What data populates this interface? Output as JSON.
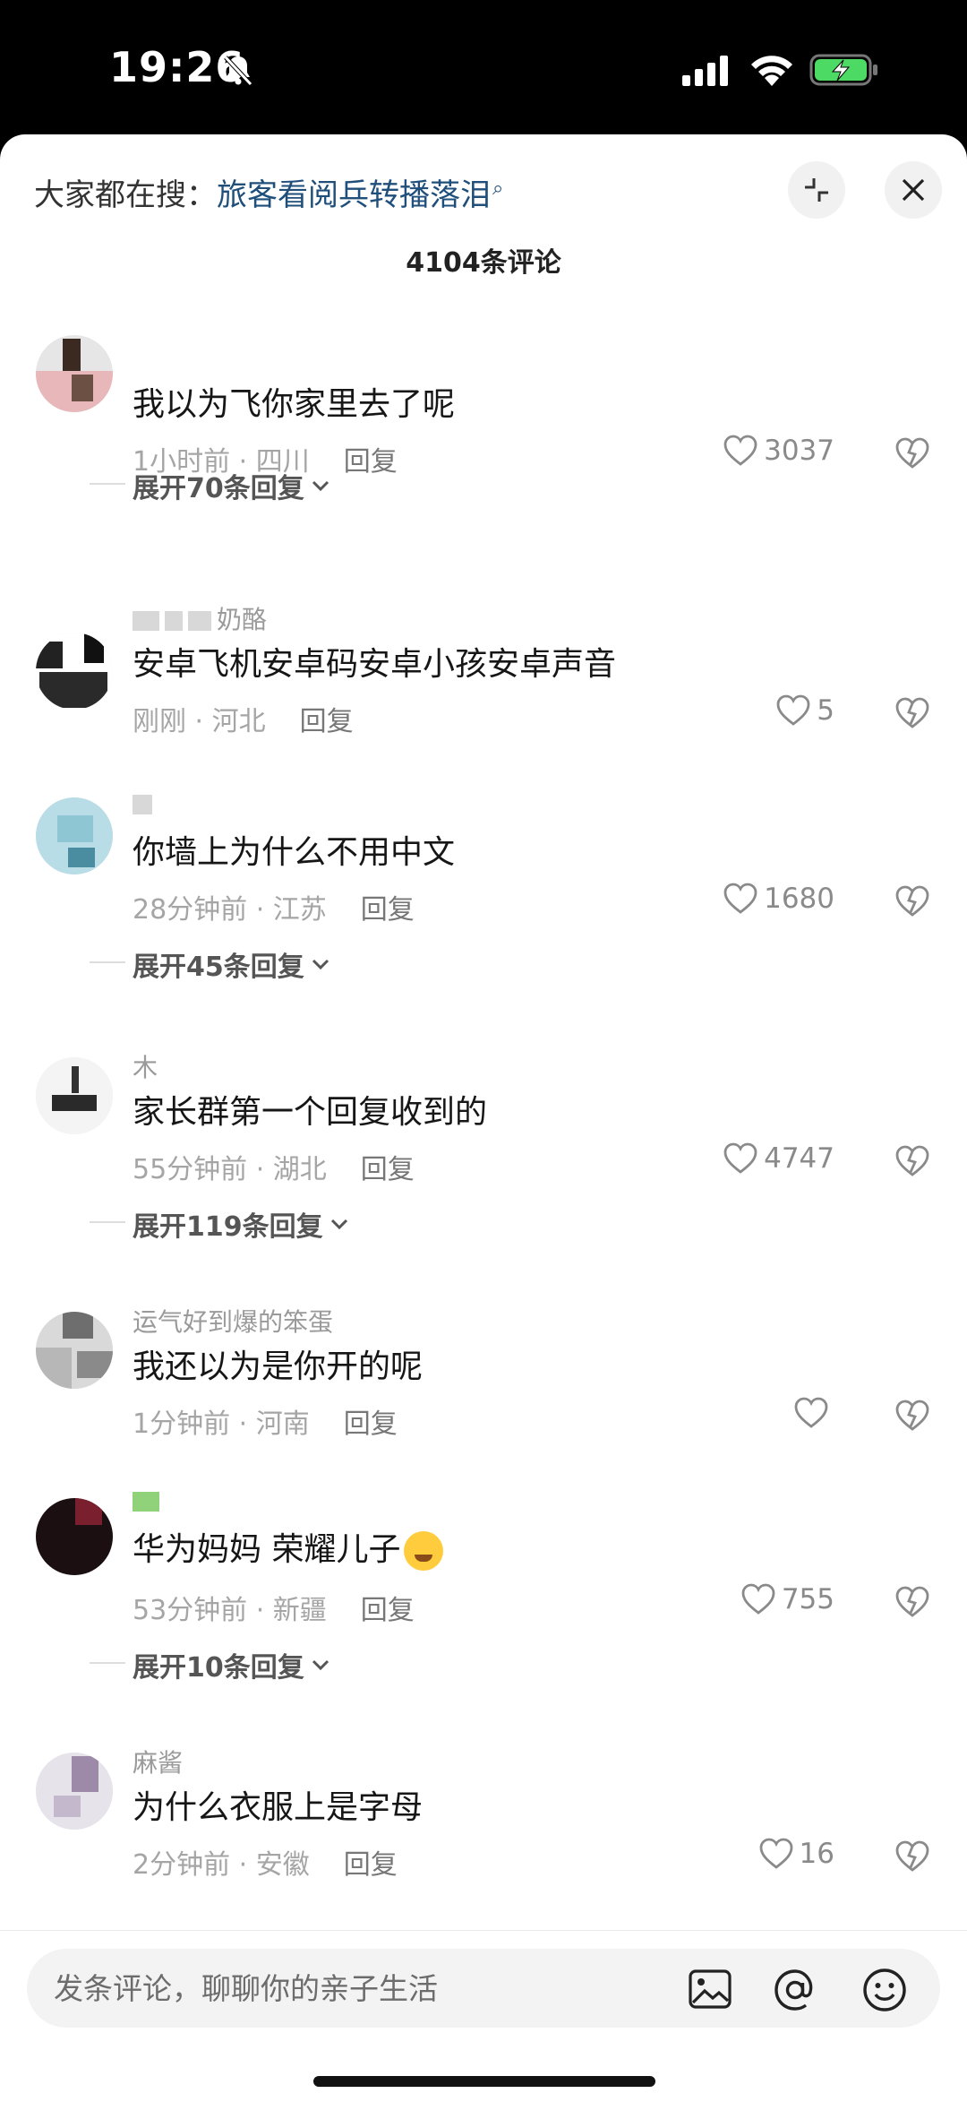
{
  "status_bar": {
    "time": "19:26",
    "icons": [
      "bell-slash-icon",
      "cellular-signal-icon",
      "wifi-icon",
      "battery-charging-icon"
    ],
    "battery_color": "#4cd964"
  },
  "header": {
    "search_prefix": "大家都在搜：",
    "search_term": "旅客看阅兵转播落泪",
    "comment_count": "4104条评论"
  },
  "comments": [
    {
      "username": "",
      "text": "我以为飞你家里去了呢",
      "time_location": "1小时前 · 四川",
      "reply": "回复",
      "likes": "3037",
      "expand": "展开70条回复"
    },
    {
      "username": "奶酪",
      "text": "安卓飞机安卓码安卓小孩安卓声音",
      "time_location": "刚刚 · 河北",
      "reply": "回复",
      "likes": "5"
    },
    {
      "username": "",
      "text": "你墙上为什么不用中文",
      "time_location": "28分钟前 · 江苏",
      "reply": "回复",
      "likes": "1680",
      "expand": "展开45条回复"
    },
    {
      "username": "木",
      "text": "家长群第一个回复收到的",
      "time_location": "55分钟前 · 湖北",
      "reply": "回复",
      "likes": "4747",
      "expand": "展开119条回复"
    },
    {
      "username": "运气好到爆的笨蛋",
      "text": "我还以为是你开的呢",
      "time_location": "1分钟前 · 河南",
      "reply": "回复",
      "likes": ""
    },
    {
      "username": "",
      "text": "华为妈妈 荣耀儿子",
      "time_location": "53分钟前 · 新疆",
      "reply": "回复",
      "likes": "755",
      "expand": "展开10条回复"
    },
    {
      "username": "麻酱",
      "text": "为什么衣服上是字母",
      "time_location": "2分钟前 · 安徽",
      "reply": "回复",
      "likes": "16"
    }
  ],
  "composer": {
    "placeholder": "发条评论，聊聊你的亲子生活"
  }
}
